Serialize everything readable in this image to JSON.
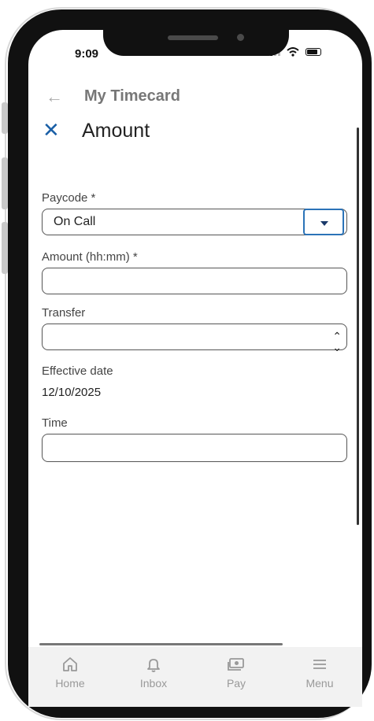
{
  "status": {
    "time": "9:09"
  },
  "header": {
    "breadcrumb": "My Timecard",
    "title": "Amount"
  },
  "form": {
    "paycode": {
      "label": "Paycode *",
      "value": "On Call"
    },
    "amount": {
      "label": "Amount (hh:mm) *",
      "value": ""
    },
    "transfer": {
      "label": "Transfer",
      "value": ""
    },
    "effective_date": {
      "label": "Effective date",
      "value": "12/10/2025"
    },
    "time": {
      "label": "Time",
      "value": ""
    }
  },
  "nav": [
    {
      "label": "Home",
      "icon": "home-icon"
    },
    {
      "label": "Inbox",
      "icon": "bell-icon"
    },
    {
      "label": "Pay",
      "icon": "money-icon"
    },
    {
      "label": "Menu",
      "icon": "menu-icon"
    }
  ],
  "colors": {
    "accent": "#1a5fa6",
    "focus": "#2b73b8"
  }
}
